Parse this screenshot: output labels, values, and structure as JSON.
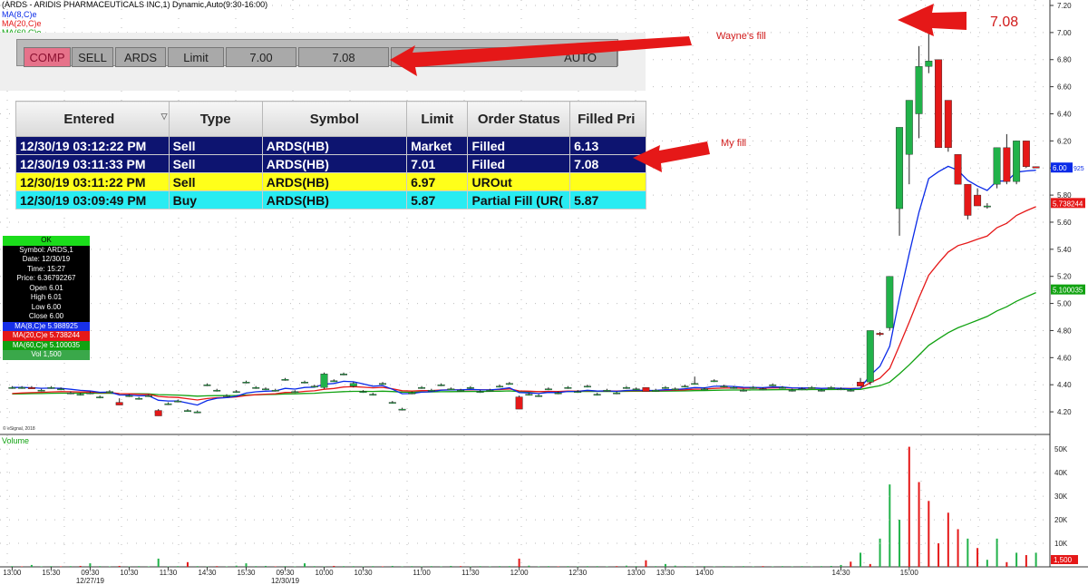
{
  "chart_data": {
    "type": "candlestick",
    "title": "(ARDS - ARIDIS PHARMACEUTICALS INC,1) Dynamic,Auto(9:30-16:00)",
    "series_labels": [
      "MA(8,C)e",
      "MA(20,C)e",
      "MA(60,C)e"
    ],
    "volume_label": "Volume",
    "ylim": [
      4.1,
      7.2
    ],
    "y_ticks": [
      "7.20",
      "7.00",
      "6.80",
      "6.60",
      "6.40",
      "6.20",
      "6.00",
      "5.80",
      "5.60",
      "5.40",
      "5.20",
      "5.00",
      "4.80",
      "4.60",
      "4.40",
      "4.20"
    ],
    "volume_ylim": [
      0,
      52000
    ],
    "volume_ticks": [
      "50K",
      "40K",
      "30K",
      "20K",
      "10K",
      "1,500"
    ],
    "x_ticks": [
      {
        "label": "13:00",
        "bar": 0
      },
      {
        "label": "15:30",
        "bar": 4
      },
      {
        "label": "09:30",
        "bar": 8
      },
      {
        "label": "10:30",
        "bar": 12
      },
      {
        "label": "11:30",
        "bar": 16
      },
      {
        "label": "14:30",
        "bar": 20
      },
      {
        "label": "15:30",
        "bar": 24
      },
      {
        "label": "09:30",
        "bar": 28
      },
      {
        "label": "10:00",
        "bar": 32
      },
      {
        "label": "10:30",
        "bar": 36
      },
      {
        "label": "11:00",
        "bar": 42
      },
      {
        "label": "11:30",
        "bar": 47
      },
      {
        "label": "12:00",
        "bar": 52
      },
      {
        "label": "12:30",
        "bar": 58
      },
      {
        "label": "13:00",
        "bar": 64
      },
      {
        "label": "13:30",
        "bar": 67
      },
      {
        "label": "14:00",
        "bar": 71
      },
      {
        "label": "14:30",
        "bar": 85
      },
      {
        "label": "15:00",
        "bar": 92
      }
    ],
    "x_date_labels": [
      {
        "label": "12/27/19",
        "bar": 8
      },
      {
        "label": "12/30/19",
        "bar": 28
      }
    ],
    "candles": [
      {
        "o": 4.38,
        "h": 4.39,
        "l": 4.37,
        "c": 4.38
      },
      {
        "o": 4.38,
        "h": 4.39,
        "l": 4.37,
        "c": 4.38
      },
      {
        "o": 4.38,
        "h": 4.39,
        "l": 4.37,
        "c": 4.37
      },
      {
        "o": 4.36,
        "h": 4.37,
        "l": 4.35,
        "c": 4.36
      },
      {
        "o": 4.38,
        "h": 4.39,
        "l": 4.37,
        "c": 4.38
      },
      {
        "o": 4.37,
        "h": 4.38,
        "l": 4.36,
        "c": 4.37
      },
      {
        "o": 4.34,
        "h": 4.35,
        "l": 4.33,
        "c": 4.34
      },
      {
        "o": 4.33,
        "h": 4.34,
        "l": 4.32,
        "c": 4.33
      },
      {
        "o": 4.34,
        "h": 4.35,
        "l": 4.33,
        "c": 4.34
      },
      {
        "o": 4.31,
        "h": 4.32,
        "l": 4.3,
        "c": 4.31
      },
      {
        "o": 4.35,
        "h": 4.36,
        "l": 4.34,
        "c": 4.35
      },
      {
        "o": 4.27,
        "h": 4.3,
        "l": 4.25,
        "c": 4.25
      },
      {
        "o": 4.32,
        "h": 4.33,
        "l": 4.31,
        "c": 4.32
      },
      {
        "o": 4.3,
        "h": 4.31,
        "l": 4.29,
        "c": 4.3
      },
      {
        "o": 4.32,
        "h": 4.33,
        "l": 4.31,
        "c": 4.32
      },
      {
        "o": 4.21,
        "h": 4.22,
        "l": 4.17,
        "c": 4.17
      },
      {
        "o": 4.26,
        "h": 4.27,
        "l": 4.25,
        "c": 4.26
      },
      {
        "o": 4.28,
        "h": 4.29,
        "l": 4.27,
        "c": 4.28
      },
      {
        "o": 4.21,
        "h": 4.22,
        "l": 4.2,
        "c": 4.21
      },
      {
        "o": 4.2,
        "h": 4.21,
        "l": 4.19,
        "c": 4.2
      },
      {
        "o": 4.4,
        "h": 4.41,
        "l": 4.39,
        "c": 4.4
      },
      {
        "o": 4.36,
        "h": 4.37,
        "l": 4.35,
        "c": 4.36
      },
      {
        "o": 4.32,
        "h": 4.33,
        "l": 4.31,
        "c": 4.32
      },
      {
        "o": 4.35,
        "h": 4.36,
        "l": 4.34,
        "c": 4.35
      },
      {
        "o": 4.42,
        "h": 4.43,
        "l": 4.41,
        "c": 4.42
      },
      {
        "o": 4.38,
        "h": 4.39,
        "l": 4.37,
        "c": 4.38
      },
      {
        "o": 4.37,
        "h": 4.38,
        "l": 4.36,
        "c": 4.37
      },
      {
        "o": 4.36,
        "h": 4.37,
        "l": 4.35,
        "c": 4.36
      },
      {
        "o": 4.44,
        "h": 4.45,
        "l": 4.43,
        "c": 4.44
      },
      {
        "o": 4.35,
        "h": 4.36,
        "l": 4.34,
        "c": 4.35
      },
      {
        "o": 4.42,
        "h": 4.43,
        "l": 4.41,
        "c": 4.42
      },
      {
        "o": 4.39,
        "h": 4.4,
        "l": 4.38,
        "c": 4.39
      },
      {
        "o": 4.38,
        "h": 4.49,
        "l": 4.37,
        "c": 4.48
      },
      {
        "o": 4.43,
        "h": 4.44,
        "l": 4.42,
        "c": 4.43
      },
      {
        "o": 4.48,
        "h": 4.49,
        "l": 4.47,
        "c": 4.48
      },
      {
        "o": 4.39,
        "h": 4.42,
        "l": 4.38,
        "c": 4.41
      },
      {
        "o": 4.35,
        "h": 4.36,
        "l": 4.34,
        "c": 4.35
      },
      {
        "o": 4.33,
        "h": 4.34,
        "l": 4.32,
        "c": 4.33
      },
      {
        "o": 4.41,
        "h": 4.42,
        "l": 4.4,
        "c": 4.41
      },
      {
        "o": 4.27,
        "h": 4.28,
        "l": 4.26,
        "c": 4.27
      },
      {
        "o": 4.22,
        "h": 4.23,
        "l": 4.21,
        "c": 4.22
      },
      {
        "o": 4.34,
        "h": 4.35,
        "l": 4.33,
        "c": 4.34
      },
      {
        "o": 4.38,
        "h": 4.39,
        "l": 4.37,
        "c": 4.38
      },
      {
        "o": 4.36,
        "h": 4.37,
        "l": 4.35,
        "c": 4.36
      },
      {
        "o": 4.4,
        "h": 4.41,
        "l": 4.39,
        "c": 4.4
      },
      {
        "o": 4.37,
        "h": 4.38,
        "l": 4.36,
        "c": 4.37
      },
      {
        "o": 4.36,
        "h": 4.37,
        "l": 4.35,
        "c": 4.36
      },
      {
        "o": 4.38,
        "h": 4.39,
        "l": 4.37,
        "c": 4.38
      },
      {
        "o": 4.35,
        "h": 4.36,
        "l": 4.34,
        "c": 4.35
      },
      {
        "o": 4.36,
        "h": 4.37,
        "l": 4.35,
        "c": 4.36
      },
      {
        "o": 4.39,
        "h": 4.4,
        "l": 4.38,
        "c": 4.39
      },
      {
        "o": 4.41,
        "h": 4.42,
        "l": 4.4,
        "c": 4.41
      },
      {
        "o": 4.31,
        "h": 4.32,
        "l": 4.22,
        "c": 4.22
      },
      {
        "o": 4.33,
        "h": 4.34,
        "l": 4.32,
        "c": 4.33
      },
      {
        "o": 4.32,
        "h": 4.33,
        "l": 4.31,
        "c": 4.32
      },
      {
        "o": 4.37,
        "h": 4.38,
        "l": 4.36,
        "c": 4.37
      },
      {
        "o": 4.34,
        "h": 4.35,
        "l": 4.33,
        "c": 4.34
      },
      {
        "o": 4.38,
        "h": 4.39,
        "l": 4.37,
        "c": 4.38
      },
      {
        "o": 4.35,
        "h": 4.36,
        "l": 4.34,
        "c": 4.35
      },
      {
        "o": 4.39,
        "h": 4.4,
        "l": 4.38,
        "c": 4.39
      },
      {
        "o": 4.33,
        "h": 4.34,
        "l": 4.32,
        "c": 4.33
      },
      {
        "o": 4.36,
        "h": 4.37,
        "l": 4.35,
        "c": 4.36
      },
      {
        "o": 4.34,
        "h": 4.35,
        "l": 4.33,
        "c": 4.34
      },
      {
        "o": 4.38,
        "h": 4.39,
        "l": 4.37,
        "c": 4.38
      },
      {
        "o": 4.37,
        "h": 4.38,
        "l": 4.36,
        "c": 4.37
      },
      {
        "o": 4.38,
        "h": 4.38,
        "l": 4.35,
        "c": 4.35
      },
      {
        "o": 4.36,
        "h": 4.37,
        "l": 4.35,
        "c": 4.36
      },
      {
        "o": 4.38,
        "h": 4.39,
        "l": 4.37,
        "c": 4.38
      },
      {
        "o": 4.37,
        "h": 4.38,
        "l": 4.36,
        "c": 4.37
      },
      {
        "o": 4.39,
        "h": 4.4,
        "l": 4.38,
        "c": 4.39
      },
      {
        "o": 4.41,
        "h": 4.46,
        "l": 4.4,
        "c": 4.41
      },
      {
        "o": 4.37,
        "h": 4.38,
        "l": 4.36,
        "c": 4.37
      },
      {
        "o": 4.43,
        "h": 4.44,
        "l": 4.42,
        "c": 4.43
      },
      {
        "o": 4.39,
        "h": 4.4,
        "l": 4.38,
        "c": 4.39
      },
      {
        "o": 4.38,
        "h": 4.39,
        "l": 4.37,
        "c": 4.38
      },
      {
        "o": 4.36,
        "h": 4.37,
        "l": 4.35,
        "c": 4.36
      },
      {
        "o": 4.38,
        "h": 4.39,
        "l": 4.37,
        "c": 4.38
      },
      {
        "o": 4.37,
        "h": 4.38,
        "l": 4.36,
        "c": 4.37
      },
      {
        "o": 4.4,
        "h": 4.41,
        "l": 4.39,
        "c": 4.4
      },
      {
        "o": 4.38,
        "h": 4.39,
        "l": 4.37,
        "c": 4.38
      },
      {
        "o": 4.36,
        "h": 4.37,
        "l": 4.35,
        "c": 4.36
      },
      {
        "o": 4.37,
        "h": 4.38,
        "l": 4.36,
        "c": 4.37
      },
      {
        "o": 4.38,
        "h": 4.39,
        "l": 4.37,
        "c": 4.38
      },
      {
        "o": 4.36,
        "h": 4.37,
        "l": 4.35,
        "c": 4.36
      },
      {
        "o": 4.38,
        "h": 4.39,
        "l": 4.37,
        "c": 4.38
      },
      {
        "o": 4.37,
        "h": 4.38,
        "l": 4.36,
        "c": 4.37
      },
      {
        "o": 4.36,
        "h": 4.37,
        "l": 4.35,
        "c": 4.36
      },
      {
        "o": 4.42,
        "h": 4.45,
        "l": 4.39,
        "c": 4.39
      },
      {
        "o": 4.42,
        "h": 4.8,
        "l": 4.4,
        "c": 4.8
      },
      {
        "o": 4.78,
        "h": 4.79,
        "l": 4.76,
        "c": 4.77
      },
      {
        "o": 4.82,
        "h": 5.2,
        "l": 4.8,
        "c": 5.2
      },
      {
        "o": 5.7,
        "h": 6.3,
        "l": 5.5,
        "c": 6.3
      },
      {
        "o": 6.1,
        "h": 6.5,
        "l": 5.88,
        "c": 6.5
      },
      {
        "o": 6.4,
        "h": 6.9,
        "l": 6.22,
        "c": 6.75
      },
      {
        "o": 6.75,
        "h": 7.08,
        "l": 6.7,
        "c": 6.79
      },
      {
        "o": 6.8,
        "h": 6.8,
        "l": 6.15,
        "c": 6.15
      },
      {
        "o": 6.5,
        "h": 6.5,
        "l": 6.12,
        "c": 6.15
      },
      {
        "o": 6.1,
        "h": 6.1,
        "l": 5.88,
        "c": 5.88
      },
      {
        "o": 5.88,
        "h": 5.88,
        "l": 5.62,
        "c": 5.65
      },
      {
        "o": 5.8,
        "h": 5.85,
        "l": 5.72,
        "c": 5.72
      },
      {
        "o": 5.72,
        "h": 5.74,
        "l": 5.7,
        "c": 5.72
      },
      {
        "o": 5.88,
        "h": 6.15,
        "l": 5.85,
        "c": 6.15
      },
      {
        "o": 6.15,
        "h": 6.25,
        "l": 5.88,
        "c": 5.9
      },
      {
        "o": 5.9,
        "h": 6.2,
        "l": 5.88,
        "c": 6.2
      },
      {
        "o": 6.2,
        "h": 6.2,
        "l": 6.0,
        "c": 6.01
      },
      {
        "o": 6.01,
        "h": 6.01,
        "l": 6.0,
        "c": 6.0
      }
    ],
    "ma8_last": 5.988925,
    "ma20_last": 5.738244,
    "ma60_last": 5.100035,
    "ma60_start": 4.33,
    "ma20_start": 4.33,
    "price_tags": [
      {
        "label": "6.00",
        "value": 6.0,
        "color": "#0a2be8"
      },
      {
        "label": "5.738244",
        "value": 5.738244,
        "color": "#e51818"
      },
      {
        "label": "5.100035",
        "value": 5.100035,
        "color": "#11a211"
      }
    ],
    "price_tag_extra": "925",
    "copyright": "© eSignal, 2018",
    "volume": [
      [
        300,
        "g"
      ],
      [
        200,
        "r"
      ],
      [
        800,
        "g"
      ],
      [
        200,
        "g"
      ],
      [
        300,
        "g"
      ],
      [
        200,
        "r"
      ],
      [
        300,
        "g"
      ],
      [
        400,
        "r"
      ],
      [
        1500,
        "g"
      ],
      [
        300,
        "g"
      ],
      [
        200,
        "g"
      ],
      [
        400,
        "r"
      ],
      [
        200,
        "g"
      ],
      [
        300,
        "g"
      ],
      [
        200,
        "g"
      ],
      [
        3500,
        "g"
      ],
      [
        200,
        "g"
      ],
      [
        300,
        "g"
      ],
      [
        2000,
        "r"
      ],
      [
        300,
        "g"
      ],
      [
        200,
        "g"
      ],
      [
        300,
        "r"
      ],
      [
        200,
        "g"
      ],
      [
        500,
        "g"
      ],
      [
        1500,
        "g"
      ],
      [
        300,
        "g"
      ],
      [
        400,
        "g"
      ],
      [
        200,
        "r"
      ],
      [
        300,
        "g"
      ],
      [
        200,
        "g"
      ],
      [
        1500,
        "g"
      ],
      [
        300,
        "g"
      ],
      [
        200,
        "g"
      ],
      [
        400,
        "r"
      ],
      [
        300,
        "g"
      ],
      [
        300,
        "g"
      ],
      [
        200,
        "g"
      ],
      [
        300,
        "g"
      ],
      [
        200,
        "r"
      ],
      [
        400,
        "g"
      ],
      [
        200,
        "g"
      ],
      [
        300,
        "g"
      ],
      [
        200,
        "g"
      ],
      [
        300,
        "g"
      ],
      [
        200,
        "g"
      ],
      [
        400,
        "g"
      ],
      [
        300,
        "r"
      ],
      [
        200,
        "g"
      ],
      [
        300,
        "g"
      ],
      [
        200,
        "g"
      ],
      [
        300,
        "g"
      ],
      [
        300,
        "g"
      ],
      [
        3500,
        "r"
      ],
      [
        500,
        "g"
      ],
      [
        200,
        "g"
      ],
      [
        300,
        "g"
      ],
      [
        200,
        "r"
      ],
      [
        300,
        "g"
      ],
      [
        200,
        "g"
      ],
      [
        300,
        "g"
      ],
      [
        300,
        "g"
      ],
      [
        200,
        "g"
      ],
      [
        300,
        "r"
      ],
      [
        500,
        "g"
      ],
      [
        300,
        "g"
      ],
      [
        2800,
        "r"
      ],
      [
        300,
        "g"
      ],
      [
        1200,
        "g"
      ],
      [
        500,
        "g"
      ],
      [
        300,
        "g"
      ],
      [
        200,
        "g"
      ],
      [
        300,
        "g"
      ],
      [
        200,
        "g"
      ],
      [
        300,
        "g"
      ],
      [
        200,
        "g"
      ],
      [
        300,
        "g"
      ],
      [
        200,
        "g"
      ],
      [
        300,
        "r"
      ],
      [
        200,
        "g"
      ],
      [
        300,
        "g"
      ],
      [
        200,
        "g"
      ],
      [
        300,
        "g"
      ],
      [
        200,
        "g"
      ],
      [
        300,
        "g"
      ],
      [
        400,
        "g"
      ],
      [
        800,
        "g"
      ],
      [
        2200,
        "r"
      ],
      [
        6000,
        "g"
      ],
      [
        1200,
        "r"
      ],
      [
        12000,
        "g"
      ],
      [
        35000,
        "g"
      ],
      [
        20000,
        "g"
      ],
      [
        51000,
        "r"
      ],
      [
        36000,
        "r"
      ],
      [
        28000,
        "r"
      ],
      [
        10000,
        "r"
      ],
      [
        23000,
        "r"
      ],
      [
        16000,
        "r"
      ],
      [
        12000,
        "g"
      ],
      [
        8000,
        "r"
      ],
      [
        3000,
        "g"
      ],
      [
        12000,
        "g"
      ],
      [
        2000,
        "r"
      ],
      [
        6000,
        "g"
      ],
      [
        5000,
        "r"
      ],
      [
        6000,
        "g"
      ],
      [
        3000,
        "g"
      ],
      [
        1200,
        "r"
      ]
    ]
  },
  "legend": {
    "title": "(ARDS - ARIDIS PHARMACEUTICALS INC,1) Dynamic,Auto(9:30-16:00)",
    "ma8": "MA(8,C)e",
    "ma20": "MA(20,C)e",
    "ma60": "MA(60,C)e"
  },
  "colors": {
    "up": "#21b24a",
    "down": "#e51818",
    "ma8": "#0a2be8",
    "ma20": "#e51818",
    "ma60": "#11a211",
    "annot": "#d11a1a"
  },
  "trade_bar": {
    "comp": "COMP",
    "side": "SELL",
    "symbol": "ARDS",
    "type": "Limit",
    "price": "7.00",
    "fill": "7.08",
    "route": "AUTO"
  },
  "orders": {
    "headers": [
      "Entered",
      "Type",
      "Symbol",
      "Limit",
      "Order Status",
      "Filled Pri"
    ],
    "rows": [
      {
        "entered": "12/30/19 03:12:22 PM",
        "type": "Sell",
        "symbol": "ARDS(HB)",
        "limit": "Market",
        "status": "Filled",
        "filled": "6.13",
        "style": "navy"
      },
      {
        "entered": "12/30/19 03:11:33 PM",
        "type": "Sell",
        "symbol": "ARDS(HB)",
        "limit": "7.01",
        "status": "Filled",
        "filled": "7.08",
        "style": "navy"
      },
      {
        "entered": "12/30/19 03:11:22 PM",
        "type": "Sell",
        "symbol": "ARDS(HB)",
        "limit": "6.97",
        "status": "UROut",
        "filled": "",
        "style": "yellow"
      },
      {
        "entered": "12/30/19 03:09:49 PM",
        "type": "Buy",
        "symbol": "ARDS(HB)",
        "limit": "5.87",
        "status": "Partial Fill (UR(",
        "filled": "5.87",
        "style": "cyan"
      }
    ]
  },
  "info_panel": {
    "ok": "OK",
    "lines": [
      "Symbol: ARDS,1",
      "Date: 12/30/19",
      "Time: 15:27",
      "Price: 6.36792267",
      "Open  6.01",
      "High  6.01",
      "Low  6.00",
      "Close  6.00"
    ],
    "ma8": "MA(8,C)e 5.988925",
    "ma20": "MA(20,C)e 5.738244",
    "ma60": "MA(60,C)e 5.100035",
    "vol": "Vol 1,500"
  },
  "annotations": {
    "wayne": "Wayne's fill",
    "my": "My fill",
    "price": "7.08"
  }
}
